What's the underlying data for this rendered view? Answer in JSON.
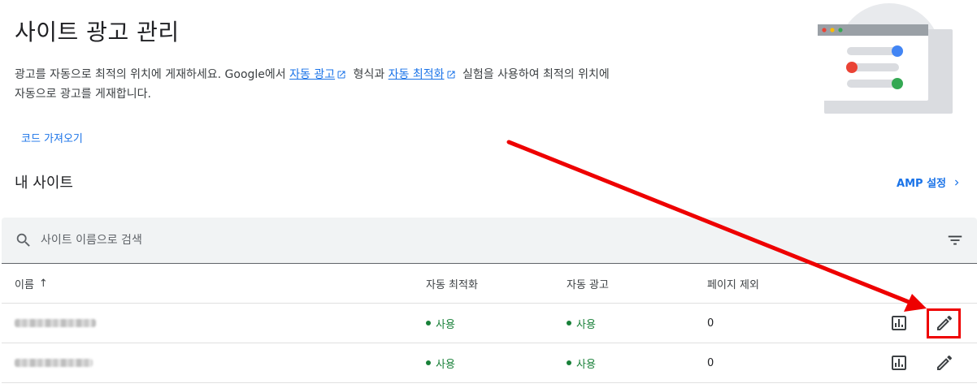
{
  "header": {
    "title": "사이트 광고 관리",
    "desc_part1": "광고를 자동으로 최적의 위치에 게재하세요. Google에서 ",
    "link_auto_ads": "자동 광고",
    "desc_part2": " 형식과 ",
    "link_auto_opt": "자동 최적화",
    "desc_part3": " 실험을 사용하여 최적의 위치에 자동으로 광고를 게재합니다.",
    "code_link": "코드 가져오기"
  },
  "section": {
    "title": "내 사이트",
    "amp_link": "AMP 설정"
  },
  "search": {
    "placeholder": "사이트 이름으로 검색"
  },
  "table": {
    "columns": [
      "이름",
      "자동 최적화",
      "자동 광고",
      "페이지 제외"
    ],
    "sort_indicator": "↑",
    "rows": [
      {
        "name": "(blurred)",
        "auto_optimization": "사용",
        "auto_ads": "사용",
        "excluded_pages": "0"
      },
      {
        "name": "(blurred)",
        "auto_optimization": "사용",
        "auto_ads": "사용",
        "excluded_pages": "0"
      }
    ]
  },
  "colors": {
    "link": "#1a73e8",
    "status_on": "#188038",
    "annotation": "#ee0000"
  },
  "icons": [
    "external-link-icon",
    "search-icon",
    "filter-icon",
    "chevron-right-icon",
    "report-icon",
    "edit-icon"
  ]
}
